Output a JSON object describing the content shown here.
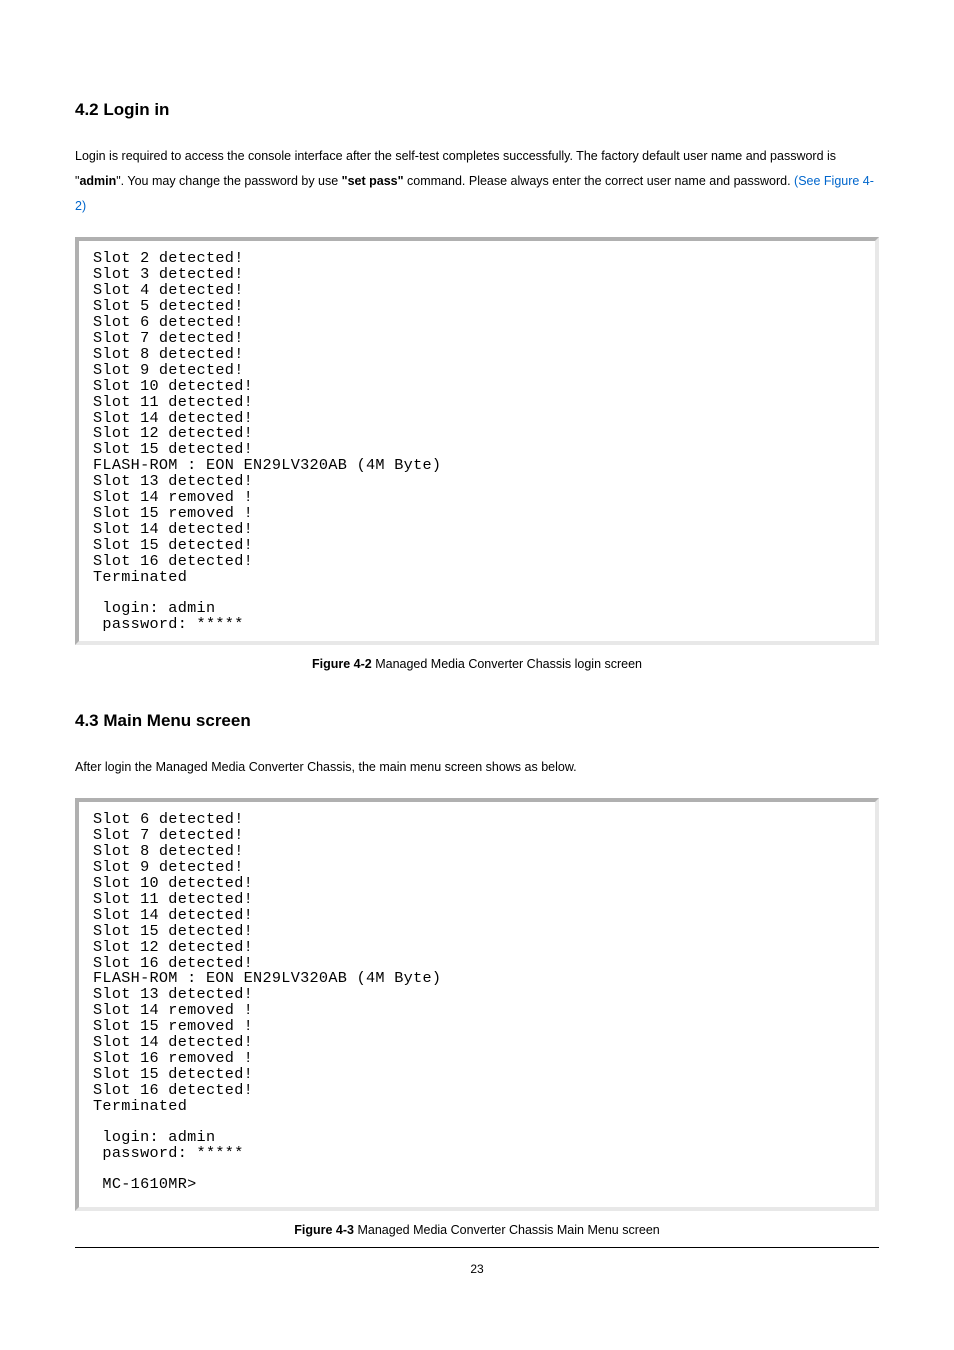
{
  "section42": {
    "heading": "4.2 Login in",
    "para_parts": {
      "p1": "Login is required to access the console interface after the self-test completes successfully. The factory default user name and password is \"",
      "p2_bold": "admin",
      "p3": "\". You may change the password by use ",
      "p4_bold": "\"set pass\"",
      "p5": " command. Please always enter the correct user name and password. ",
      "p6_link": "(See Figure 4-2)"
    },
    "terminal": [
      "Slot 2 detected!",
      "Slot 3 detected!",
      "Slot 4 detected!",
      "Slot 5 detected!",
      "Slot 6 detected!",
      "Slot 7 detected!",
      "Slot 8 detected!",
      "Slot 9 detected!",
      "Slot 10 detected!",
      "Slot 11 detected!",
      "Slot 14 detected!",
      "Slot 12 detected!",
      "Slot 15 detected!",
      "FLASH-ROM : EON EN29LV320AB (4M Byte)",
      "Slot 13 detected!",
      "Slot 14 removed !",
      "Slot 15 removed !",
      "Slot 14 detected!",
      "Slot 15 detected!",
      "Slot 16 detected!",
      "Terminated",
      "",
      " login: admin",
      " password: *****"
    ],
    "caption_bold": "Figure 4-2",
    "caption_rest": " Managed Media Converter Chassis login screen"
  },
  "section43": {
    "heading": "4.3 Main Menu screen",
    "para": "After login the Managed Media Converter Chassis, the main menu screen shows as below.",
    "terminal": [
      "Slot 6 detected!",
      "Slot 7 detected!",
      "Slot 8 detected!",
      "Slot 9 detected!",
      "Slot 10 detected!",
      "Slot 11 detected!",
      "Slot 14 detected!",
      "Slot 15 detected!",
      "Slot 12 detected!",
      "Slot 16 detected!",
      "FLASH-ROM : EON EN29LV320AB (4M Byte)",
      "Slot 13 detected!",
      "Slot 14 removed !",
      "Slot 15 removed !",
      "Slot 14 detected!",
      "Slot 16 removed !",
      "Slot 15 detected!",
      "Slot 16 detected!",
      "Terminated",
      "",
      " login: admin",
      " password: *****",
      "",
      " MC-1610MR>"
    ],
    "caption_bold": "Figure 4-3",
    "caption_rest": " Managed Media Converter Chassis Main Menu screen"
  },
  "page_number": "23"
}
